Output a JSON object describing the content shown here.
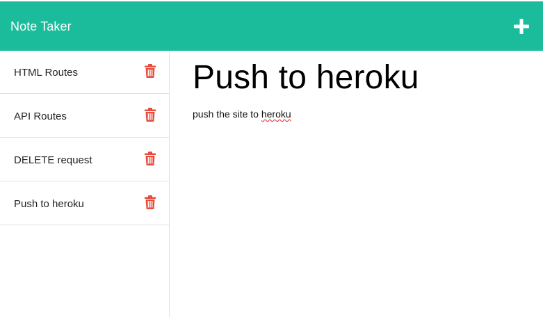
{
  "navbar": {
    "brand": "Note Taker",
    "new_note_icon": "plus-icon",
    "accent_color": "#1abc9c"
  },
  "sidebar": {
    "notes": [
      {
        "title": "HTML Routes",
        "delete_icon": "trash-icon"
      },
      {
        "title": "API Routes",
        "delete_icon": "trash-icon"
      },
      {
        "title": "DELETE request",
        "delete_icon": "trash-icon"
      },
      {
        "title": "Push to heroku",
        "delete_icon": "trash-icon"
      }
    ],
    "delete_color": "#e74c3c"
  },
  "main": {
    "note_title": "Push to heroku",
    "note_text_prefix": "push the site to ",
    "note_text_misspelled": "heroku"
  }
}
